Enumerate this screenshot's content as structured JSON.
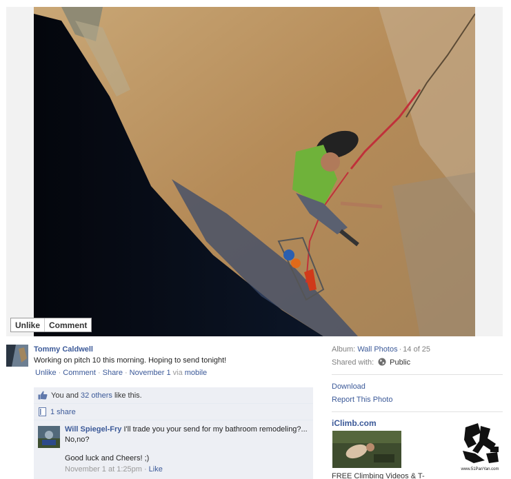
{
  "photo_actions": {
    "unlike": "Unlike",
    "comment": "Comment"
  },
  "post": {
    "author": "Tommy Caldwell",
    "message": "Working on pitch 10 this morning. Hoping to send tonight!",
    "actions": {
      "unlike": "Unlike",
      "comment": "Comment",
      "share": "Share"
    },
    "time": "November 1",
    "via_prefix": "via",
    "via": "mobile"
  },
  "feedback": {
    "likes_prefix": "You and",
    "likes_others": "32 others",
    "likes_suffix": "like this.",
    "shares": "1 share"
  },
  "comment": {
    "author": "Will Spiegel-Fry",
    "text": "I'll trade you your send for my bathroom remodeling?... No,no?",
    "text2": "Good luck and Cheers! ;)",
    "time": "November 1 at 1:25pm",
    "like": "Like"
  },
  "sidebar": {
    "album_label": "Album:",
    "album_name": "Wall Photos",
    "album_position": "14 of 25",
    "shared_label": "Shared with:",
    "shared_value": "Public",
    "download": "Download",
    "report": "Report This Photo"
  },
  "ad": {
    "title": "iClimb.com",
    "logo_caption": "www.51PanYan.com",
    "text": "FREE Climbing Videos & T-"
  }
}
